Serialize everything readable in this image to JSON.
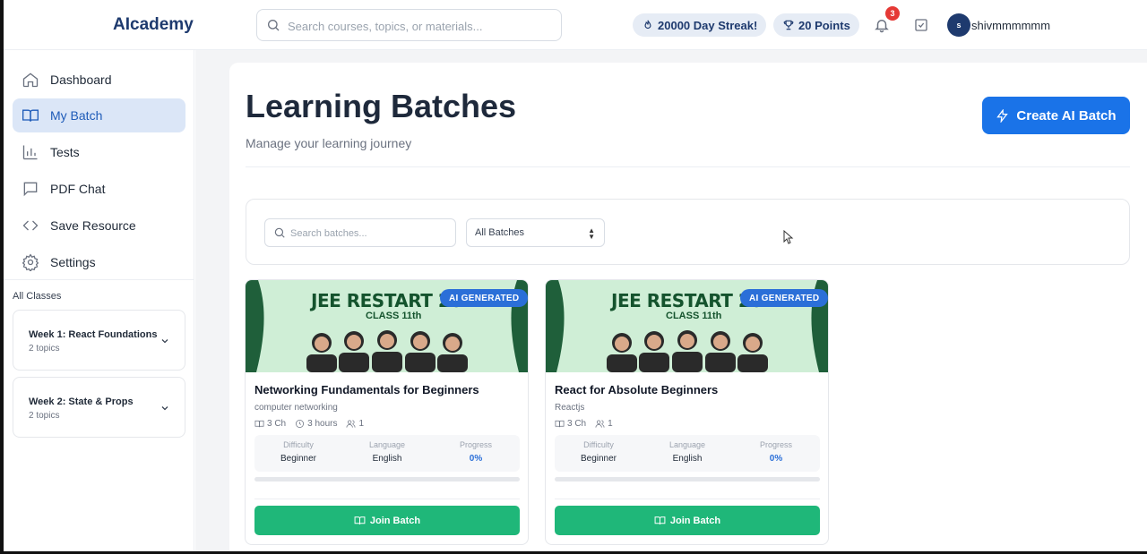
{
  "header": {
    "logo": "AIcademy",
    "search_placeholder": "Search courses, topics, or materials...",
    "streak": "20000 Day Streak!",
    "points": "20 Points",
    "notifications_count": "3",
    "avatar_initial": "s",
    "username": "shivmmmmmm"
  },
  "sidebar": {
    "items": [
      {
        "label": "Dashboard",
        "icon": "home-icon"
      },
      {
        "label": "My Batch",
        "icon": "book-open-icon",
        "active": true
      },
      {
        "label": "Tests",
        "icon": "bar-chart-icon"
      },
      {
        "label": "PDF Chat",
        "icon": "message-square-icon"
      },
      {
        "label": "Save Resource",
        "icon": "code-icon"
      },
      {
        "label": "Settings",
        "icon": "gear-icon"
      }
    ],
    "all_classes_label": "All Classes",
    "classes": [
      {
        "title": "Week 1: React Foundations",
        "topics": "2 topics"
      },
      {
        "title": "Week 2: State & Props",
        "topics": "2 topics"
      }
    ]
  },
  "main": {
    "title": "Learning Batches",
    "subtitle": "Manage your learning journey",
    "create_button": "Create AI Batch",
    "batch_search_placeholder": "Search batches...",
    "batch_filter_value": "All Batches"
  },
  "labels": {
    "difficulty": "Difficulty",
    "language": "Language",
    "progress": "Progress",
    "join": "Join Batch"
  },
  "cards": [
    {
      "thumb_title": "JEE RESTART 202",
      "thumb_class": "CLASS 11th",
      "badge": "AI GENERATED",
      "title": "Networking Fundamentals for Beginners",
      "category": "computer networking",
      "chapters": "3 Ch",
      "duration": "3 hours",
      "members": "1",
      "difficulty": "Beginner",
      "language": "English",
      "progress": "0%"
    },
    {
      "thumb_title": "JEE RESTART 202",
      "thumb_class": "CLASS 11th",
      "badge": "AI GENERATED",
      "title": "React for Absolute Beginners",
      "category": "Reactjs",
      "chapters": "3 Ch",
      "members": "1",
      "difficulty": "Beginner",
      "language": "English",
      "progress": "0%"
    }
  ],
  "colors": {
    "brand_navy": "#1e3a6e",
    "primary_blue": "#1a73e8",
    "join_green": "#1fb779",
    "active_nav_bg": "#dbe6f7",
    "thumb_dark_green": "#1f5f3a",
    "thumb_light_green": "#cfeed6"
  }
}
